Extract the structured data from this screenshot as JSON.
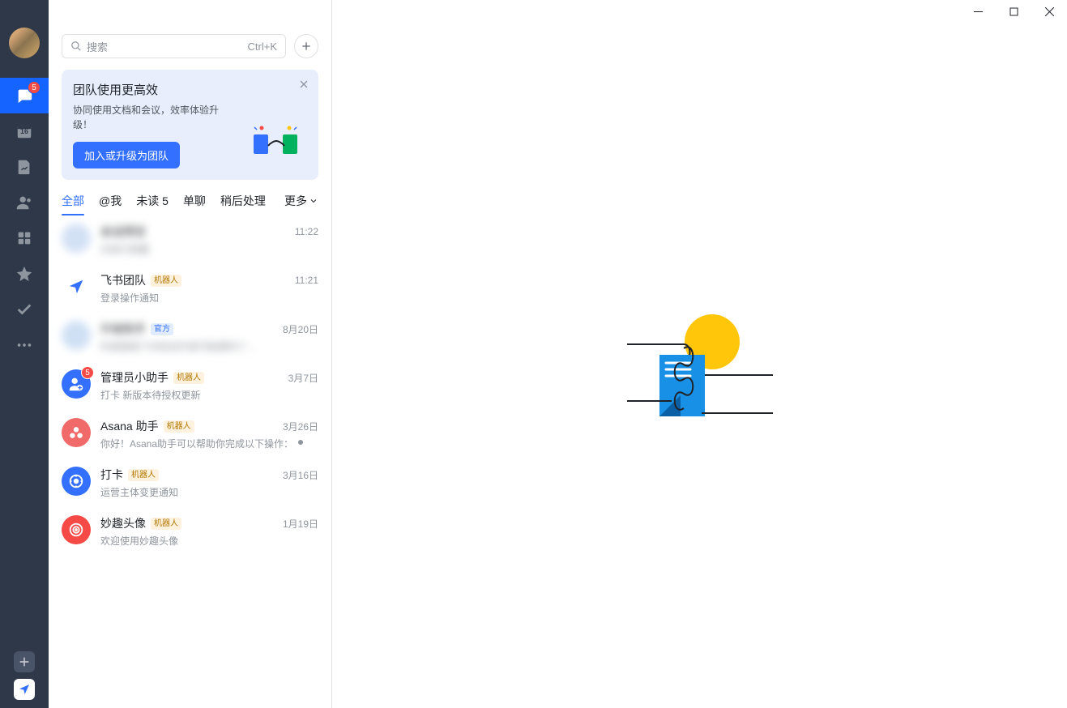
{
  "nav": {
    "messages_badge": "5",
    "calendar_date": "16"
  },
  "search": {
    "placeholder": "搜索",
    "shortcut": "Ctrl+K"
  },
  "promo": {
    "title": "团队使用更高效",
    "desc": "协同使用文档和会议，效率体验升级！",
    "button": "加入或升级为团队"
  },
  "filters": {
    "all": "全部",
    "at_me": "@我",
    "unread": "未读 5",
    "single": "单聊",
    "later": "稍后处理",
    "more": "更多"
  },
  "tags": {
    "bot": "机器人",
    "official": "官方"
  },
  "conversations": [
    {
      "name": "会话预览",
      "preview": "内容已隐藏",
      "time": "11:22",
      "tag": null,
      "avatar_bg": "#d3e1f5",
      "icon": "blur",
      "badge": null,
      "dot": false
    },
    {
      "name": "飞书团队",
      "preview": "登录操作通知",
      "time": "11:21",
      "tag": "bot",
      "avatar_bg": "#ffffff",
      "icon": "plane",
      "badge": null,
      "dot": false
    },
    {
      "name": "升级助手",
      "preview": "的桌面端飞书自动升级可能遇到了…",
      "time": "8月20日",
      "tag": "official",
      "avatar_bg": "#cfe0f4",
      "icon": "blur",
      "badge": null,
      "dot": false
    },
    {
      "name": "管理员小助手",
      "preview": "打卡 新版本待授权更新",
      "time": "3月7日",
      "tag": "bot",
      "avatar_bg": "#3370ff",
      "icon": "admin",
      "badge": "5",
      "dot": false
    },
    {
      "name": "Asana 助手",
      "preview": "你好！Asana助手可以帮助你完成以下操作：",
      "time": "3月26日",
      "tag": "bot",
      "avatar_bg": "#f06a6a",
      "icon": "asana",
      "badge": null,
      "dot": true
    },
    {
      "name": "打卡",
      "preview": "运营主体变更通知",
      "time": "3月16日",
      "tag": "bot",
      "avatar_bg": "#3370ff",
      "icon": "clock",
      "badge": null,
      "dot": false
    },
    {
      "name": "妙趣头像",
      "preview": "欢迎使用妙趣头像",
      "time": "1月19日",
      "tag": "bot",
      "avatar_bg": "#f54a45",
      "icon": "target",
      "badge": null,
      "dot": false
    }
  ]
}
